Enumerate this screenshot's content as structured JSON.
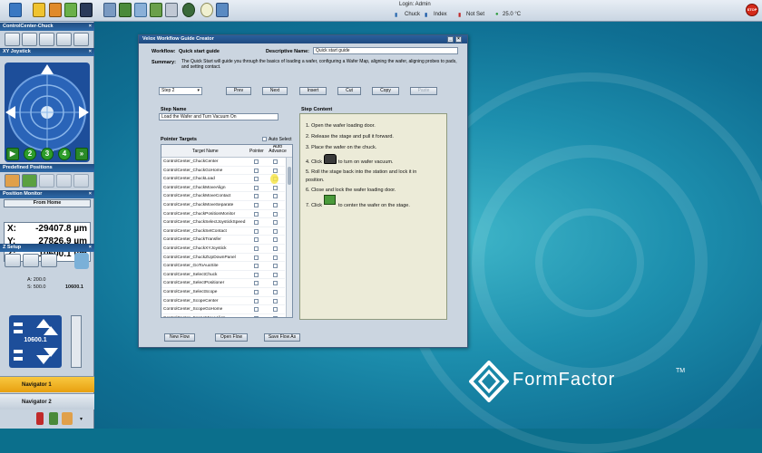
{
  "topbar": {
    "login_label": "Login: Admin",
    "chuck_label": "Chuck",
    "index_label": "Index",
    "notset_label": "Not Set",
    "temperature": "25.0 °C",
    "stop_label": "STOP"
  },
  "sidebar": {
    "controlcenter_title": "ControlCenter-Chuck",
    "xy_joystick_title": "XY Joystick",
    "speed_buttons": [
      "2",
      "3",
      "4"
    ],
    "predefined_title": "Predefined Positions",
    "position_title": "Position Monitor",
    "from_home": "From Home",
    "positions": [
      {
        "axis": "X:",
        "value": "-29407.8 µm"
      },
      {
        "axis": "Y:",
        "value": "27826.9 µm"
      },
      {
        "axis": "Z:",
        "value": "10600.1 µm"
      }
    ],
    "zsetup_title": "Z Setup",
    "z_a": "A: 200.0",
    "z_s": "S: 500.0",
    "z_value_right": "10600.1",
    "z_value_pad": "10600.1",
    "navigators": [
      {
        "label": "Navigator 1"
      },
      {
        "label": "Navigator 2"
      }
    ]
  },
  "dialog": {
    "title": "Velox Workflow Guide Creator",
    "workflow_label": "Workflow:",
    "workflow_value": "Quick start guide",
    "descriptive_label": "Descriptive Name:",
    "descriptive_value": "Quick start guide",
    "summary_label": "Summary:",
    "summary_text": "The Quick Start will guide you through the basics of loading a wafer, configuring a Wafer Map, aligning the wafer, aligning probes to pads, and setting contact.",
    "step_select": "Step 2",
    "buttons": {
      "prev": "Prev",
      "next": "Next",
      "insert": "Insert",
      "cut": "Cut",
      "copy": "Copy",
      "paste": "Paste"
    },
    "step_name_label": "Step Name",
    "step_name_value": "Load the Wafer and Turn Vacuum On",
    "pointer_targets_label": "Pointer Targets",
    "auto_select_label": "Auto Select",
    "col_target": "Target Name",
    "col_pointer": "Pointer",
    "col_auto": "Auto Advance",
    "targets": [
      "ControlCenter_ChuckCenter",
      "ControlCenter_ChuckGoHome",
      "ControlCenter_ChuckLoad",
      "ControlCenter_ChuckMoveAlign",
      "ControlCenter_ChuckMoveContact",
      "ControlCenter_ChuckMoveSeparate",
      "ControlCenter_ChuckPositionMonitor",
      "ControlCenter_ChuckSelectJoystickSpeed",
      "ControlCenter_ChuckSetContact",
      "ControlCenter_ChuckTransfer",
      "ControlCenter_ChuckXYJoystick",
      "ControlCenter_ChuckZUpDownPanel",
      "ControlCenter_GoToAuxSite",
      "ControlCenter_SelectChuck",
      "ControlCenter_SelectPositioner",
      "ControlCenter_SelectScope",
      "ControlCenter_ScopeCenter",
      "ControlCenter_ScopeGoHome",
      "ControlCenter_ScopeMoveAlign"
    ],
    "step_content_label": "Step Content",
    "step_content": [
      "1. Open the wafer loading door.",
      "2. Release the stage and pull it forward.",
      "3. Place the wafer on the chuck.",
      "4. Click",
      "to turn on wafer vacuum.",
      "5. Roll the stage back into the station and lock it in",
      "position.",
      "6. Close and lock the wafer loading door.",
      "7. Click",
      "to center the wafer on the stage."
    ],
    "bottom_buttons": {
      "new_flow": "New Flow",
      "open_flow": "Open Flow",
      "save_flow": "Save Flow As"
    }
  },
  "brand": {
    "name": "FormFactor",
    "tm": "TM"
  },
  "colors": {
    "accent_blue": "#1f4b80",
    "joystick_blue": "#1d4e9a",
    "nav_active": "#f2b51d",
    "stop_red": "#d42a1a"
  }
}
